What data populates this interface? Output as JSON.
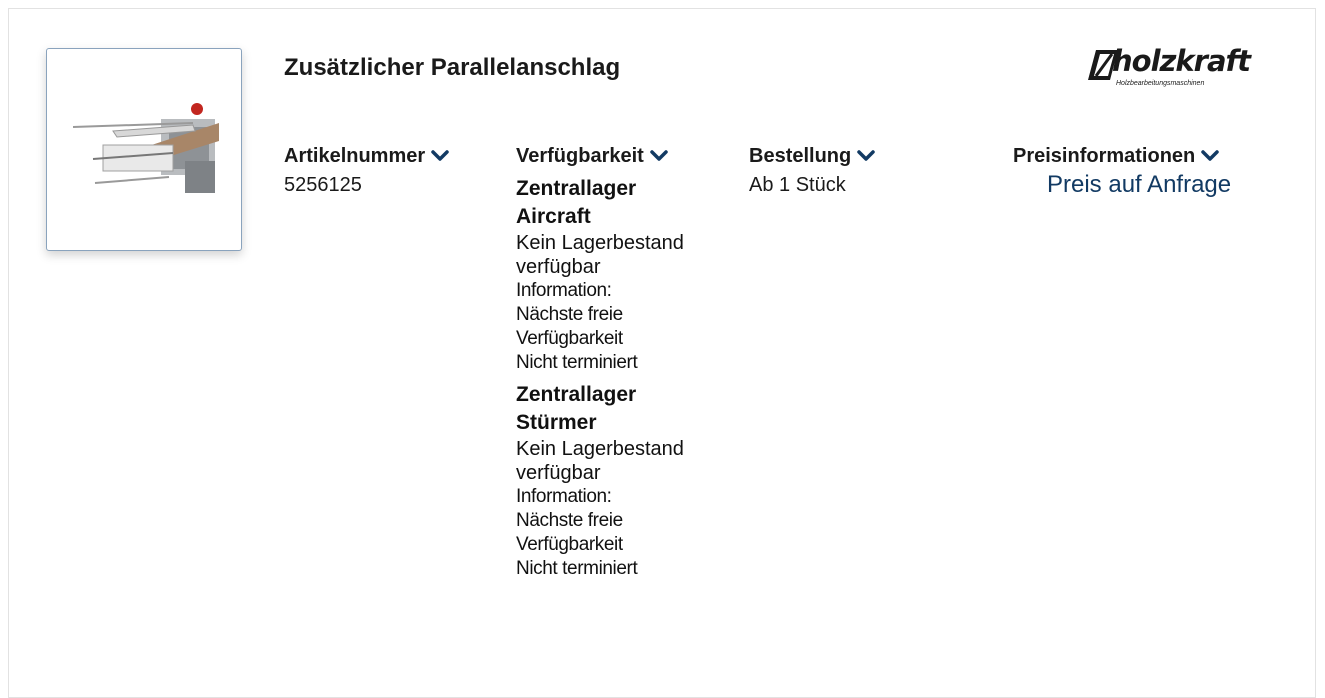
{
  "product": {
    "title": "Zusätzlicher Parallelanschlag",
    "image_icon": "table-saw-parallel-fence-image"
  },
  "logo": {
    "wordmark": "holzkraft",
    "tagline": "Holzbearbeitungsmaschinen"
  },
  "columns": {
    "article": {
      "label": "Artikelnummer",
      "value": "5256125"
    },
    "availability": {
      "label": "Verfügbarkeit",
      "warehouses": [
        {
          "name_line1": "Zentrallager",
          "name_line2": "Aircraft",
          "status_line1": "Kein Lagerbestand",
          "status_line2": "verfügbar",
          "info_line1": "Information:",
          "info_line2": "Nächste freie",
          "info_line3": "Verfügbarkeit",
          "info_line4": "Nicht terminiert"
        },
        {
          "name_line1": "Zentrallager",
          "name_line2": "Stürmer",
          "status_line1": "Kein Lagerbestand",
          "status_line2": "verfügbar",
          "info_line1": "Information:",
          "info_line2": "Nächste freie",
          "info_line3": "Verfügbarkeit",
          "info_line4": "Nicht terminiert"
        }
      ]
    },
    "order": {
      "label": "Bestellung",
      "value": "Ab 1 Stück"
    },
    "price": {
      "label": "Preisinformationen",
      "value": "Preis auf Anfrage"
    }
  },
  "colors": {
    "accent": "#123a63",
    "text": "#1a1a1a",
    "border": "#e2e2e2"
  },
  "icons": {
    "expand": "chevron-down-icon"
  }
}
